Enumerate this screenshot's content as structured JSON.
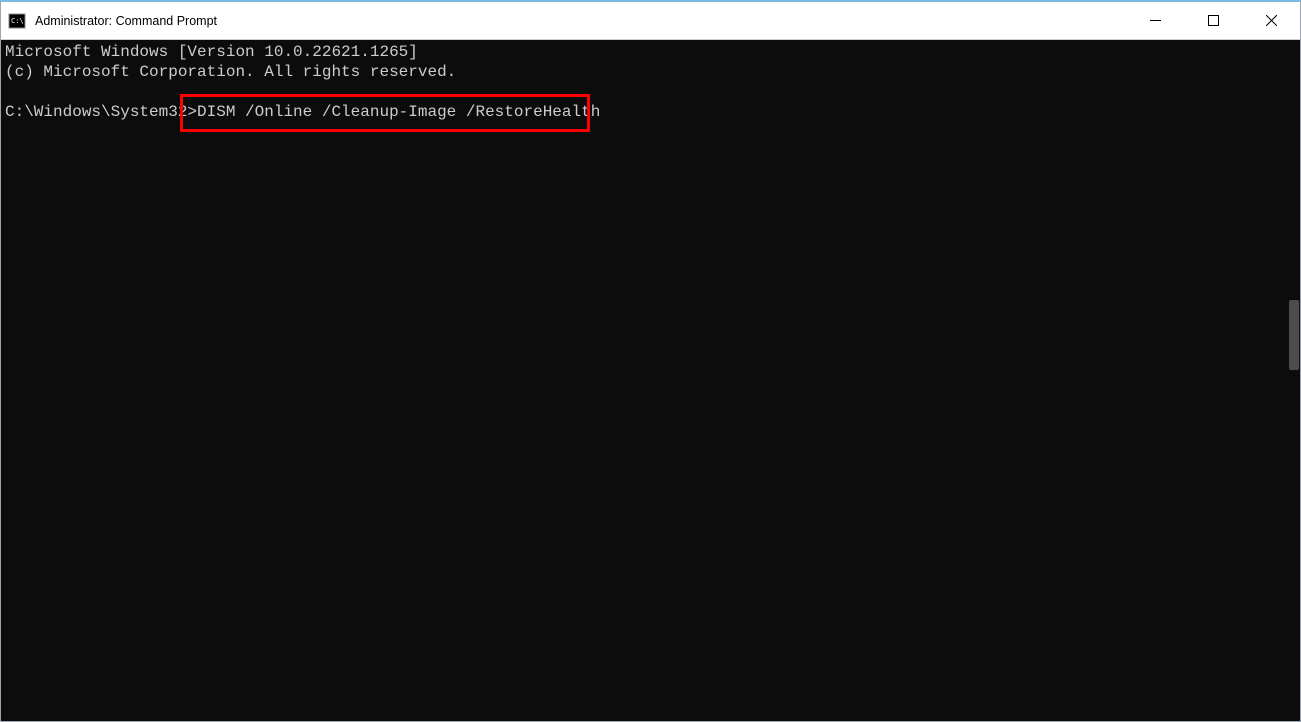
{
  "window": {
    "title": "Administrator: Command Prompt"
  },
  "terminal": {
    "line1": "Microsoft Windows [Version 10.0.22621.1265]",
    "line2": "(c) Microsoft Corporation. All rights reserved.",
    "prompt_prefix": "C:\\Windows\\System32>",
    "command": "DISM /Online /Cleanup-Image /RestoreHealth"
  }
}
